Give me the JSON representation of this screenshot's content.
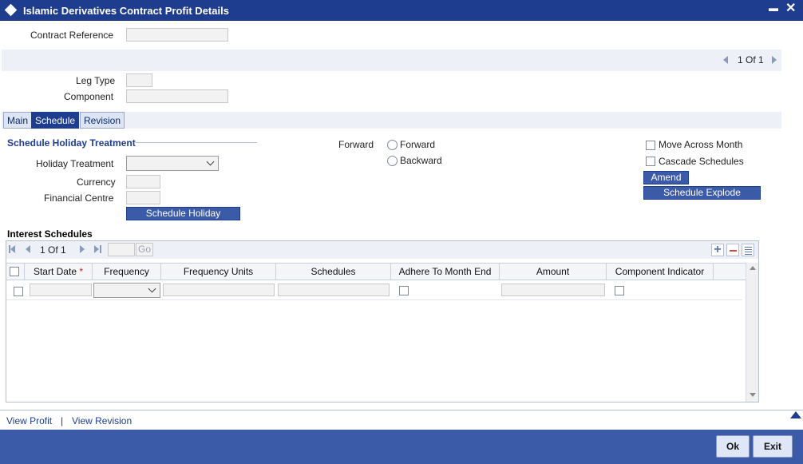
{
  "window": {
    "title": "Islamic Derivatives Contract Profit Details",
    "minimize_glyph": "▬",
    "close_glyph": "✕"
  },
  "header": {
    "contract_reference_label": "Contract Reference",
    "contract_reference_value": ""
  },
  "pager": {
    "current": "1",
    "of_label": "Of",
    "total": "1"
  },
  "leg": {
    "leg_type_label": "Leg Type",
    "leg_type_value": "",
    "component_label": "Component",
    "component_value": ""
  },
  "tabs": [
    {
      "label": "Main"
    },
    {
      "label": "Schedule",
      "active": true
    },
    {
      "label": "Revision"
    }
  ],
  "schedule_holiday": {
    "section_title": "Schedule Holiday Treatment",
    "holiday_treatment_label": "Holiday Treatment",
    "holiday_treatment_value": "",
    "currency_label": "Currency",
    "currency_value": "",
    "financial_centre_label": "Financial Centre",
    "financial_centre_value": "",
    "schedule_holiday_button": "Schedule Holiday"
  },
  "forward": {
    "label": "Forward",
    "options": [
      {
        "label": "Forward"
      },
      {
        "label": "Backward"
      }
    ]
  },
  "options": {
    "move_across_month_label": "Move Across Month",
    "cascade_schedules_label": "Cascade Schedules",
    "amend_button": "Amend",
    "schedule_explode_button": "Schedule Explode"
  },
  "interest_schedules": {
    "title": "Interest Schedules",
    "pager": {
      "current": "1",
      "of_label": "Of",
      "total": "1",
      "go_label": "Go"
    },
    "columns": [
      "Start Date",
      "Frequency",
      "Frequency Units",
      "Schedules",
      "Adhere To Month End",
      "Amount",
      "Component Indicator"
    ],
    "required_marker": "*"
  },
  "links": {
    "view_profit": "View Profit",
    "separator": "|",
    "view_revision": "View Revision"
  },
  "footer": {
    "ok_label": "Ok",
    "exit_label": "Exit"
  },
  "colors": {
    "title_bar": "#1f3d8f",
    "footer_bar": "#3b5aa8",
    "accent": "#1f3d8f"
  }
}
